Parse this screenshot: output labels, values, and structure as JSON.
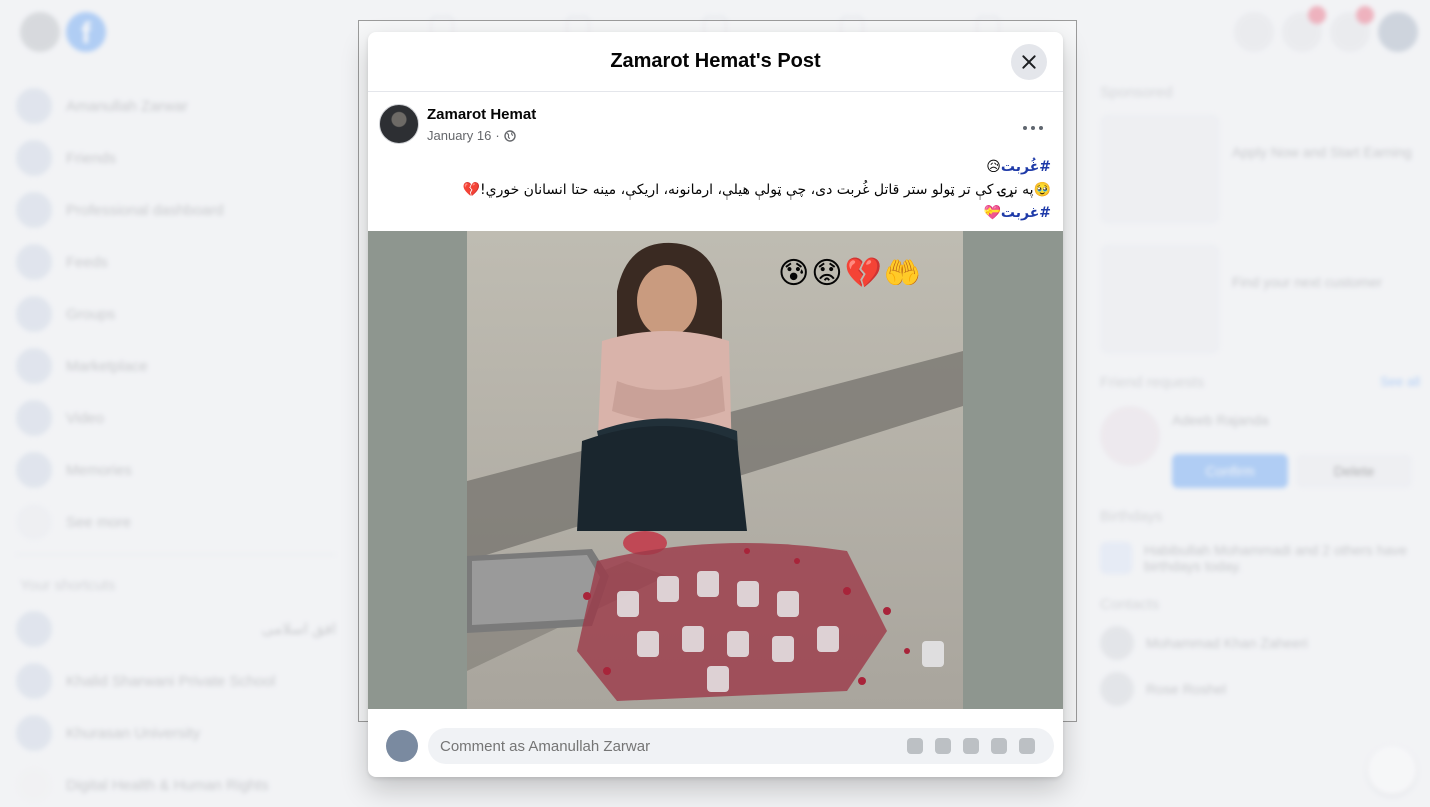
{
  "background": {
    "left_nav": {
      "items": [
        {
          "label": "Amanullah Zarwar"
        },
        {
          "label": "Friends"
        },
        {
          "label": "Professional dashboard"
        },
        {
          "label": "Feeds"
        },
        {
          "label": "Groups"
        },
        {
          "label": "Marketplace"
        },
        {
          "label": "Video"
        },
        {
          "label": "Memories"
        },
        {
          "label": "See more"
        }
      ],
      "shortcuts_heading": "Your shortcuts",
      "shortcuts": [
        {
          "label": "افق اسلامی"
        },
        {
          "label": "Khalid Sharwani Private School"
        },
        {
          "label": "Khurasan University"
        },
        {
          "label": "Digital Health & Human Rights"
        }
      ]
    },
    "right_col": {
      "sponsored_heading": "Sponsored",
      "ads": [
        {
          "title": "Apply Now and Start Earning"
        },
        {
          "title": "Find your next customer"
        }
      ],
      "friend_requests_heading": "Friend requests",
      "see_all": "See all",
      "friend_request": {
        "name": "Adeeb Rajanda",
        "confirm": "Confirm",
        "delete": "Delete"
      },
      "birthdays_heading": "Birthdays",
      "birthday_text": "Habibullah Mohammadi and 2 others have birthdays today.",
      "contacts_heading": "Contacts",
      "contacts": [
        {
          "name": "Mohammad Khan Zaheeri"
        },
        {
          "name": "Rose Roshel"
        }
      ]
    }
  },
  "modal": {
    "title": "Zamarot Hemat's Post",
    "post": {
      "author": "Zamarot Hemat",
      "date": "January 16",
      "separator": "·",
      "lines": [
        {
          "hashtag": "#غُربت",
          "text": "",
          "emoji": "😥"
        },
        {
          "hashtag": "",
          "text": "په نړۍ کې تر ټولو ستر قاتل غُربت دی، چې ټولې هیلې، ارمانونه، اریکې، مینه حتا انسانان خوري!",
          "emoji": "💔",
          "lead_emoji": "🥹"
        },
        {
          "hashtag": "#غربت",
          "text": "",
          "emoji": "💝"
        }
      ],
      "photo_emojis": "😰😟💔🤲"
    },
    "comment": {
      "placeholder": "Comment as Amanullah Zarwar"
    }
  }
}
